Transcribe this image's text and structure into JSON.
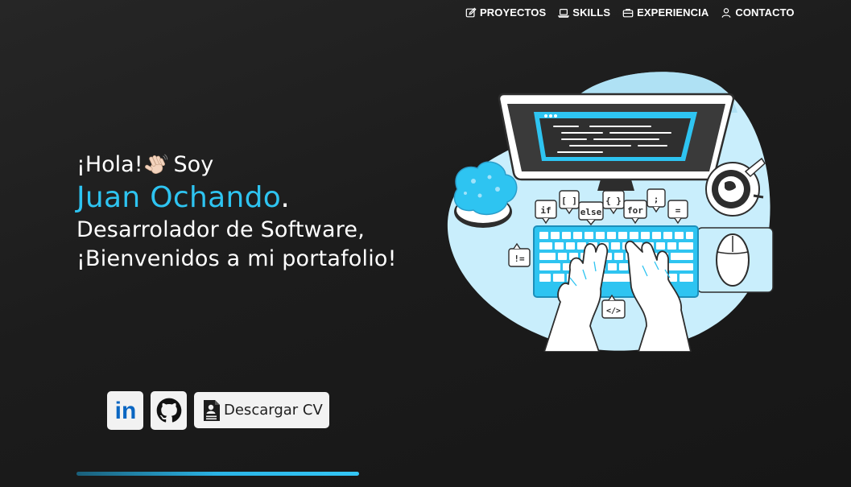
{
  "nav": {
    "items": [
      {
        "label": "PROYECTOS",
        "icon": "edit-icon"
      },
      {
        "label": "SKILLS",
        "icon": "laptop-icon"
      },
      {
        "label": "EXPERIENCIA",
        "icon": "briefcase-icon"
      },
      {
        "label": "CONTACTO",
        "icon": "person-icon"
      }
    ]
  },
  "hero": {
    "greeting_before": "¡Hola!",
    "greeting_after": "Soy",
    "name": "Juan Ochando",
    "name_suffix": ".",
    "role_line1": "Desarrolador de Software,",
    "role_line2": "¡Bienvenidos a mi portafolio!"
  },
  "social": {
    "linkedin_text": "in",
    "cv_label": "Descargar CV"
  },
  "illustration": {
    "code_tags": [
      "if",
      "[ ]",
      "else",
      "{ }",
      "for",
      ";",
      "=",
      "!=",
      "</>"
    ]
  },
  "colors": {
    "accent": "#2ec4f1",
    "background": "#1e1e1e",
    "button_bg": "#f2f2f2",
    "linkedin": "#0a66c2"
  }
}
